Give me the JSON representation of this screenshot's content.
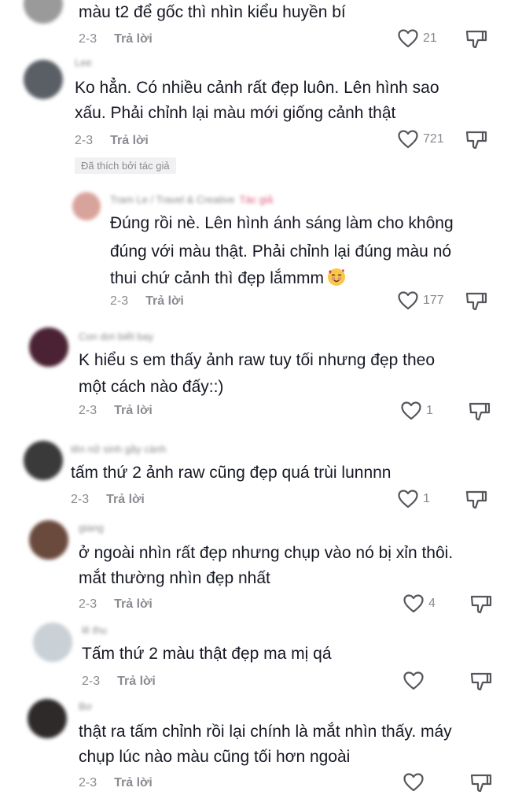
{
  "reply_label": "Trả lời",
  "comments": [
    {
      "text": [
        "màu t2 để gốc thì nhìn kiểu huyền bí"
      ],
      "date": "2-3",
      "likes": "21",
      "avatar_color": "#9a9a9a"
    },
    {
      "username": "Lee",
      "text": [
        "Ko hẳn. Có nhiều cảnh rất đẹp luôn. Lên hình sao",
        "xấu. Phải chỉnh lại màu mới giống cảnh thật"
      ],
      "date": "2-3",
      "likes": "721",
      "badge": "Đã thích bởi tác giả",
      "avatar_color": "#5a5f66"
    },
    {
      "username": "Tram Le / Travel & Creative",
      "tag": "Tác giả",
      "text": [
        "Đúng rồi nè. Lên hình ánh sáng làm cho không",
        "đúng với màu thật. Phải chỉnh lại đúng màu nó",
        "thui chứ cảnh thì đẹp lắmmm"
      ],
      "emoji": "smiling-face-with-hearts",
      "date": "2-3",
      "likes": "177",
      "avatar_color": "#d8a39a"
    },
    {
      "username": "Con dơi biết bay",
      "text": [
        "K hiểu s em thấy ảnh raw tuy tối nhưng đẹp theo",
        "một cách nào đấy::)"
      ],
      "date": "2-3",
      "likes": "1",
      "avatar_color": "#4b2233"
    },
    {
      "username": "tên nữ sinh gầy cành",
      "text": [
        "tấm thứ 2 ảnh raw cũng đẹp quá trùi lunnnn"
      ],
      "date": "2-3",
      "likes": "1",
      "avatar_color": "#3a3a3a"
    },
    {
      "username": "giang",
      "text": [
        "ở ngoài nhìn rất đẹp nhưng chụp vào nó bị xỉn thôi.",
        "mắt thường nhìn đẹp nhất"
      ],
      "date": "2-3",
      "likes": "4",
      "avatar_color": "#6b4a3e"
    },
    {
      "username": "lê thu",
      "text": [
        "Tấm thứ 2 màu thật đẹp ma mị qá"
      ],
      "date": "2-3",
      "likes": "",
      "avatar_color": "#c9d0d6"
    },
    {
      "username": "Bơ",
      "text": [
        "thật ra tấm chỉnh rồi lại chính là mắt nhìn thấy. máy",
        "chụp lúc nào màu cũng tối hơn ngoài"
      ],
      "date": "2-3",
      "likes": "",
      "avatar_color": "#2e2a2a"
    }
  ]
}
